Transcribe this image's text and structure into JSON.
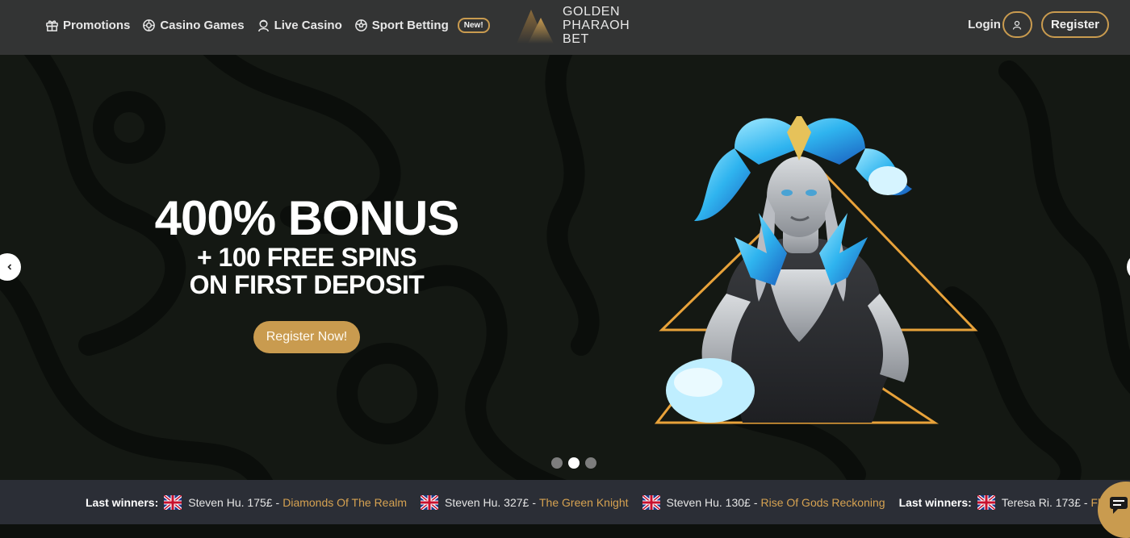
{
  "header": {
    "nav": [
      {
        "label": "Promotions",
        "icon": "gift-icon"
      },
      {
        "label": "Casino Games",
        "icon": "chip-icon"
      },
      {
        "label": "Live Casino",
        "icon": "dealer-icon"
      },
      {
        "label": "Sport Betting",
        "icon": "football-icon"
      }
    ],
    "new_badge": "New!",
    "logo": {
      "line1": "GOLDEN",
      "line2": "PHARAOH",
      "line3": "BET"
    },
    "login_label": "Login",
    "register_label": "Register"
  },
  "hero": {
    "headline": "400% BONUS",
    "subline1": "+ 100 FREE SPINS",
    "subline2": "ON FIRST DEPOSIT",
    "cta_label": "Register Now!",
    "active_slide": 2,
    "slide_count": 3
  },
  "ticker": {
    "label": "Last winners:",
    "winners": [
      {
        "name": "Steven Hu. 175£",
        "game": "Diamonds Of The Realm"
      },
      {
        "name": "Steven Hu. 327£",
        "game": "The Green Knight"
      },
      {
        "name": "Steven Hu. 130£",
        "game": "Rise Of Gods Reckoning"
      },
      {
        "name": "Teresa Ri. 173£",
        "game": "Flow"
      }
    ]
  },
  "colors": {
    "accent_gold": "#c99b4f",
    "header_bg": "#333434",
    "ticker_bg": "#2b2e36",
    "hero_bg": "#141813"
  }
}
